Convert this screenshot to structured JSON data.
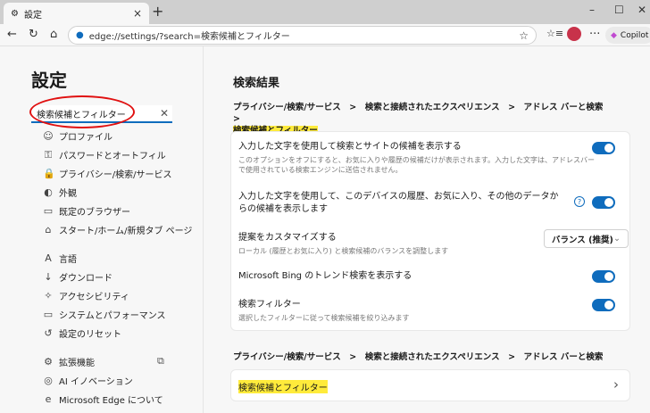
{
  "tab": {
    "title": "設定",
    "close": "×",
    "new": "+"
  },
  "window": {
    "min": "–",
    "max": "☐",
    "close": "✕"
  },
  "address": {
    "url": "edge://settings/?search=検索候補とフィルター",
    "copilot": "Copilot"
  },
  "sidebar": {
    "title": "設定",
    "search_value": "検索候補とフィルター",
    "items": [
      {
        "icon": "☺",
        "label": "プロファイル"
      },
      {
        "icon": "⚿",
        "label": "パスワードとオートフィル"
      },
      {
        "icon": "🔒",
        "label": "プライバシー/検索/サービス"
      },
      {
        "icon": "◐",
        "label": "外観"
      },
      {
        "icon": "▭",
        "label": "既定のブラウザー"
      },
      {
        "icon": "⌂",
        "label": "スタート/ホーム/新規タブ ページ"
      },
      {
        "icon": "A",
        "label": "言語"
      },
      {
        "icon": "↓",
        "label": "ダウンロード"
      },
      {
        "icon": "✧",
        "label": "アクセシビリティ"
      },
      {
        "icon": "▭",
        "label": "システムとパフォーマンス"
      },
      {
        "icon": "↺",
        "label": "設定のリセット"
      },
      {
        "icon": "⚙",
        "label": "拡張機能"
      },
      {
        "icon": "◎",
        "label": "AI イノベーション"
      },
      {
        "icon": "e",
        "label": "Microsoft Edge について"
      }
    ]
  },
  "main": {
    "title": "検索結果",
    "crumb1": "プライバシー/検索/サービス　>　検索と接続されたエクスペリエンス　>　アドレス バーと検索　>",
    "crumb1_hl": "検索候補とフィルター",
    "rows": [
      {
        "title": "入力した文字を使用して検索とサイトの候補を表示する",
        "desc": "このオプションをオフにすると、お気に入りや履歴の候補だけが表示されます。入力した文字は、アドレスバーで使用されている検索エンジンに送信されません。",
        "on": true
      },
      {
        "title": "入力した文字を使用して、このデバイスの履歴、お気に入り、その他のデータからの候補を表示します",
        "desc": "",
        "on": true
      },
      {
        "title": "提案をカスタマイズする",
        "desc": "ローカル (履歴とお気に入り) と検索候補のバランスを調整します",
        "select": "バランス (推奨)"
      },
      {
        "title": "Microsoft Bing のトレンド検索を表示する",
        "desc": "",
        "on": true
      },
      {
        "title": "検索フィルター",
        "desc": "選択したフィルターに従って検索候補を絞り込みます",
        "on": true
      }
    ],
    "crumb2": "プライバシー/検索/サービス　>　検索と接続されたエクスペリエンス　>　アドレス バーと検索",
    "link": "検索候補とフィルター",
    "help": "?",
    "chev": "›",
    "selchev": "⌄"
  }
}
